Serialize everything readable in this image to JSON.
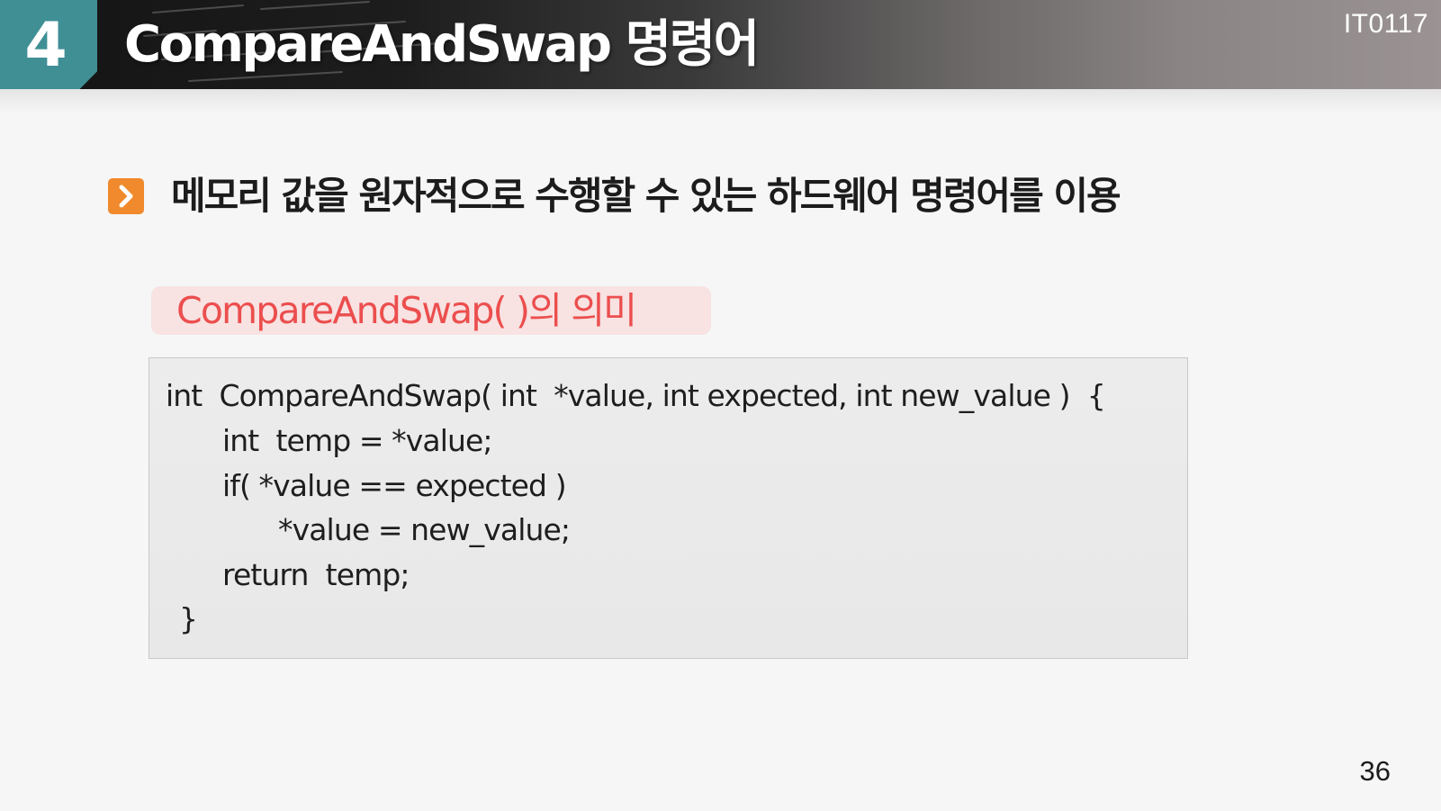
{
  "header": {
    "section_number": "4",
    "title": "CompareAndSwap 명령어",
    "course_code": "IT0117"
  },
  "bullet": {
    "icon": "chevron-right-icon",
    "text": "메모리 값을 원자적으로 수행할 수 있는 하드웨어 명령어를 이용"
  },
  "subheading": {
    "text": "CompareAndSwap( )의 의미"
  },
  "code": {
    "lines": [
      "int  CompareAndSwap( int  *value, int expected, int new_value )  {",
      "int  temp = *value;",
      "if( *value == expected )",
      "*value = new_value;",
      "return  temp;",
      "}"
    ]
  },
  "page_number": "36",
  "colors": {
    "section_badge": "#3f8f95",
    "bullet_icon": "#f08a2c",
    "subheading_text": "#ec4e4e",
    "subheading_background": "#f8e2e2",
    "code_background": "#ececec"
  }
}
